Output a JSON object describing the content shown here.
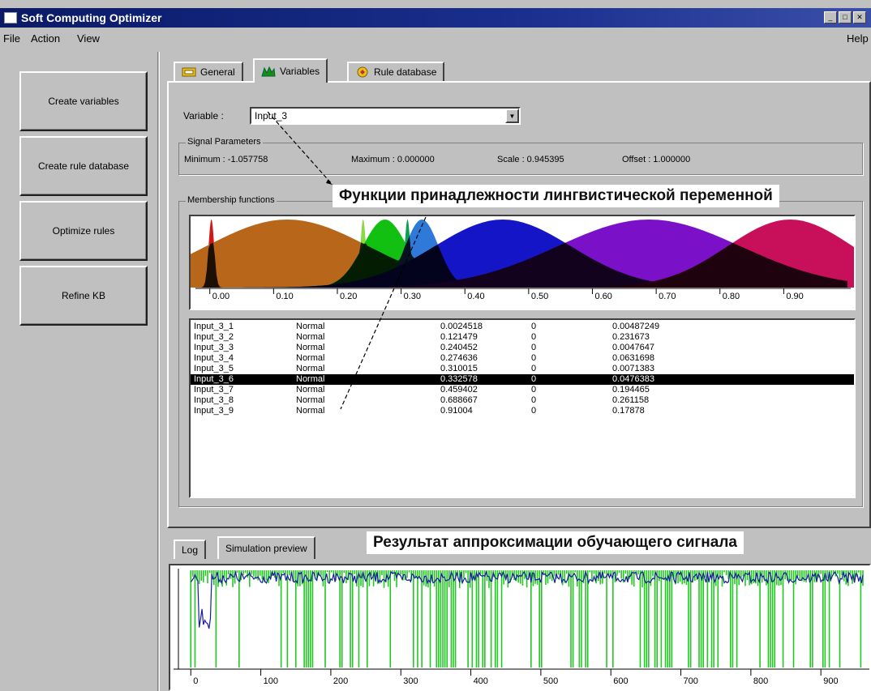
{
  "window": {
    "title": "Soft Computing Optimizer"
  },
  "menu": {
    "items": [
      "File",
      "Action",
      "View"
    ],
    "help": "Help"
  },
  "sidebar": {
    "buttons": [
      "Create variables",
      "Create rule database",
      "Optimize rules",
      "Refine KB"
    ]
  },
  "tabs": [
    {
      "label": "General",
      "icon": "general-tab-icon"
    },
    {
      "label": "Variables",
      "icon": "chart-tab-icon"
    },
    {
      "label": "Rule database",
      "icon": "rule-tab-icon"
    }
  ],
  "variable": {
    "label": "Variable :",
    "selected": "Input_3"
  },
  "signal": {
    "title": "Signal Parameters",
    "minimum": "Minimum : -1.057758",
    "maximum": "Maximum : 0.000000",
    "scale": "Scale : 0.945395",
    "offset": "Offset : 1.000000"
  },
  "membership": {
    "title": "Membership functions"
  },
  "annotations": {
    "mf_caption": "Функции принадлежности лингвистической переменной",
    "sim_caption": "Результат аппроксимации обучающего сигнала"
  },
  "functions": [
    {
      "name": "Input_3_1",
      "type": "Normal",
      "center": "0.0024518",
      "zero": "0",
      "width": "0.00487249"
    },
    {
      "name": "Input_3_2",
      "type": "Normal",
      "center": "0.121479",
      "zero": "0",
      "width": "0.231673"
    },
    {
      "name": "Input_3_3",
      "type": "Normal",
      "center": "0.240452",
      "zero": "0",
      "width": "0.0047647"
    },
    {
      "name": "Input_3_4",
      "type": "Normal",
      "center": "0.274636",
      "zero": "0",
      "width": "0.0631698"
    },
    {
      "name": "Input_3_5",
      "type": "Normal",
      "center": "0.310015",
      "zero": "0",
      "width": "0.0071383"
    },
    {
      "name": "Input_3_6",
      "type": "Normal",
      "center": "0.332578",
      "zero": "0",
      "width": "0.0476383"
    },
    {
      "name": "Input_3_7",
      "type": "Normal",
      "center": "0.459402",
      "zero": "0",
      "width": "0.194465"
    },
    {
      "name": "Input_3_8",
      "type": "Normal",
      "center": "0.688667",
      "zero": "0",
      "width": "0.261158"
    },
    {
      "name": "Input_3_9",
      "type": "Normal",
      "center": "0.91004",
      "zero": "0",
      "width": "0.17878"
    }
  ],
  "selected_function": "Input_3_6",
  "bottom_tabs": [
    "Log",
    "Simulation preview"
  ],
  "chart_data": [
    {
      "type": "area",
      "x_ticks": [
        "0.00",
        "0.10",
        "0.20",
        "0.30",
        "0.40",
        "0.50",
        "0.60",
        "0.70",
        "0.80",
        "0.90"
      ],
      "xlim": [
        -0.02,
        1.0
      ],
      "ylim": [
        0,
        1
      ],
      "series": [
        {
          "center": 0.0024518,
          "width": 0.00487249,
          "color": "#d01818"
        },
        {
          "center": 0.121479,
          "width": 0.231673,
          "color": "#b8661a"
        },
        {
          "center": 0.240452,
          "width": 0.0047647,
          "color": "#8ad848"
        },
        {
          "center": 0.274636,
          "width": 0.0631698,
          "color": "#11c011"
        },
        {
          "center": 0.310015,
          "width": 0.0071383,
          "color": "#0aa050"
        },
        {
          "center": 0.332578,
          "width": 0.0476383,
          "color": "#2f7ad8"
        },
        {
          "center": 0.459402,
          "width": 0.194465,
          "color": "#1515c8"
        },
        {
          "center": 0.688667,
          "width": 0.261158,
          "color": "#7a10c8"
        },
        {
          "center": 0.91004,
          "width": 0.17878,
          "color": "#c8105a"
        }
      ],
      "overlap_color": "#000000"
    },
    {
      "type": "line",
      "x_ticks": [
        "0",
        "100",
        "200",
        "300",
        "400",
        "500",
        "600",
        "700",
        "800",
        "900"
      ],
      "xlim": [
        -20,
        960
      ],
      "series": [
        {
          "color": "#1a1aa0"
        },
        {
          "color": "#22c822"
        }
      ]
    }
  ]
}
